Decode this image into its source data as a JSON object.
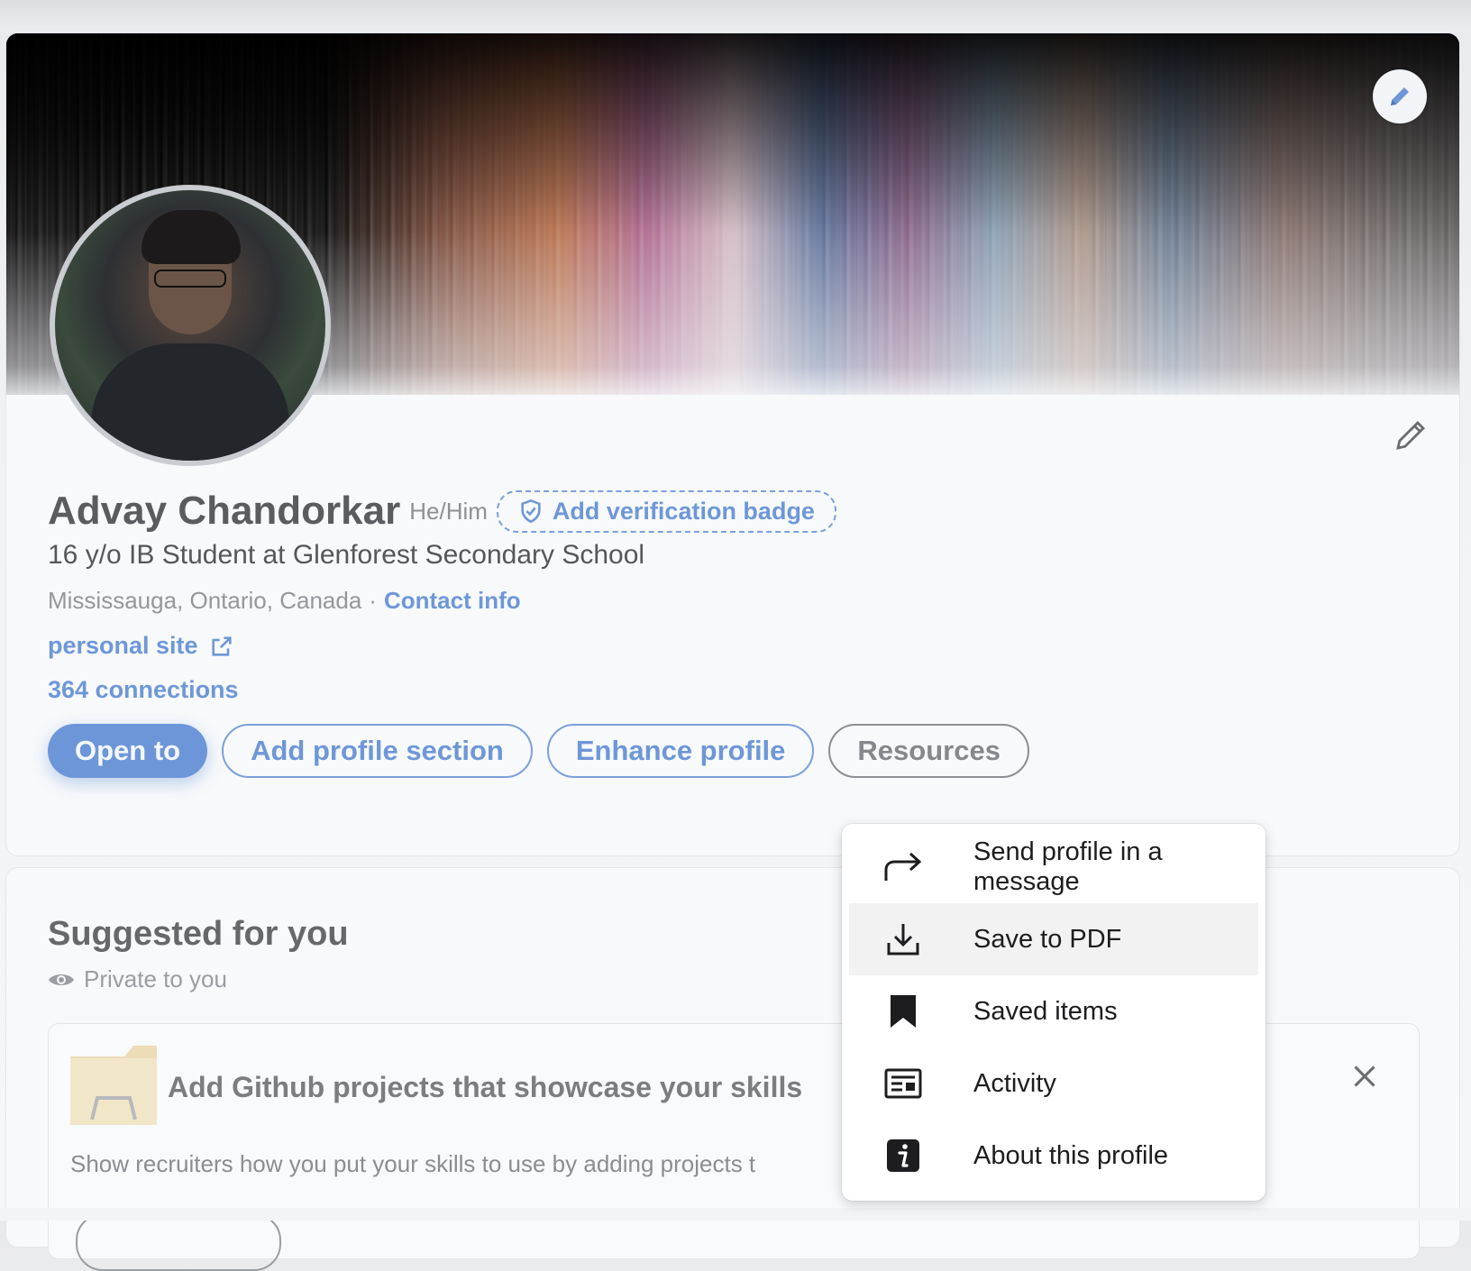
{
  "profile": {
    "name": "Advay Chandorkar",
    "pronouns": "He/Him",
    "verification_label": "Add verification badge",
    "headline": "16 y/o IB Student at Glenforest Secondary School",
    "location": "Mississauga, Ontario, Canada",
    "separator": "·",
    "contact_info": "Contact info",
    "personal_site": "personal site",
    "connections": "364 connections"
  },
  "actions": {
    "open_to": "Open to",
    "add_section": "Add profile section",
    "enhance": "Enhance profile",
    "resources": "Resources"
  },
  "suggested": {
    "title": "Suggested for you",
    "privacy": "Private to you",
    "card_title": "Add Github projects that showcase your skills",
    "card_text": "Show recruiters how you put your skills to use by adding projects t"
  },
  "menu": {
    "items": [
      {
        "label": "Send profile in a message",
        "icon": "share-arrow-icon"
      },
      {
        "label": "Save to PDF",
        "icon": "download-icon"
      },
      {
        "label": "Saved items",
        "icon": "bookmark-icon"
      },
      {
        "label": "Activity",
        "icon": "activity-icon"
      },
      {
        "label": "About this profile",
        "icon": "info-icon"
      }
    ]
  },
  "colors": {
    "accent": "#6e97d8",
    "menu_hover": "#f2f2f2"
  }
}
